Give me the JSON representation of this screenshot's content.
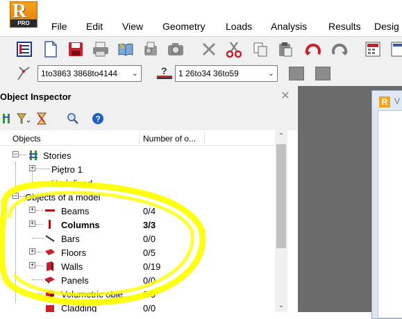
{
  "app": {
    "logo_letter": "R",
    "logo_badge": "PRO"
  },
  "menu": [
    "File",
    "Edit",
    "View",
    "Geometry",
    "Loads",
    "Analysis",
    "Results",
    "Desig"
  ],
  "toolbar": {
    "icons": [
      "table-icon",
      "new-document-icon",
      "save-icon",
      "print-icon",
      "open-book-icon",
      "print-preview-icon",
      "screen-capture-icon",
      "delete-icon",
      "cut-icon",
      "copy-icon",
      "paste-icon",
      "undo-icon",
      "redo-icon",
      "calculator-icon",
      "tables-icon"
    ]
  },
  "selection": {
    "nodes_value": "1to3863 3868to4144",
    "bars_value": "1 26to34 36to59"
  },
  "inspector": {
    "title": "Object Inspector",
    "columns": {
      "objects": "Objects",
      "number": "Number of o..."
    },
    "tree": [
      {
        "label": "Stories",
        "value": ""
      },
      {
        "label": "Piętro 1",
        "value": ""
      },
      {
        "label": "Undefined",
        "value": ""
      },
      {
        "label": "Objects of a model",
        "value": ""
      },
      {
        "label": "Beams",
        "value": "0/4"
      },
      {
        "label": "Columns",
        "value": "3/3"
      },
      {
        "label": "Bars",
        "value": "0/0"
      },
      {
        "label": "Floors",
        "value": "0/5"
      },
      {
        "label": "Walls",
        "value": "0/19"
      },
      {
        "label": "Panels",
        "value": "0/0"
      },
      {
        "label": "Volumetric obje...",
        "value": "0/0"
      },
      {
        "label": "Cladding",
        "value": "0/0"
      }
    ]
  },
  "document": {
    "title_fragment": "V"
  },
  "colors": {
    "highlight": "#ffff00",
    "logo": "#f4a31c",
    "panel_bg": "#f0f0f0",
    "workspace": "#6b6b6b"
  }
}
